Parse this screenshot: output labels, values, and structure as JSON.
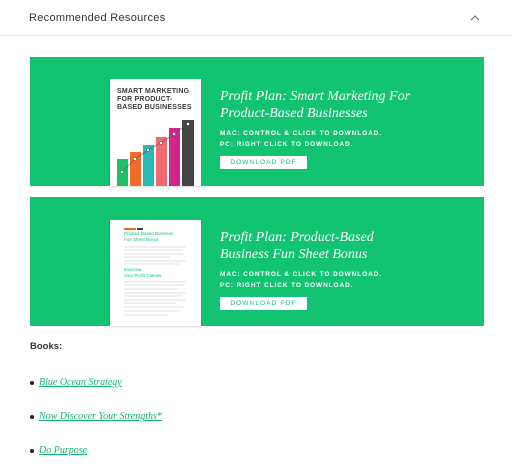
{
  "section": {
    "title": "Recommended Resources",
    "toggle_icon": "chevron-up-icon"
  },
  "colors": {
    "accent_green": "#12c472",
    "link_green": "#12b36b",
    "bar_green": "#1fbf6a",
    "bar_orange": "#f26b2b",
    "bar_teal": "#27b9b4",
    "bar_pink": "#ef6b6f",
    "bar_magenta": "#d0268c",
    "bar_dark": "#444444"
  },
  "resources": [
    {
      "cover_title": "SMART MARKETING FOR PRODUCT-BASED BUSINESSES",
      "title_line1": "Profit Plan: Smart Marketing For",
      "title_line2": "Product-Based Businesses",
      "instr_mac": "MAC: CONTROL & CLICK TO DOWNLOAD.",
      "instr_pc": "PC: RIGHT CLICK TO DOWNLOAD.",
      "button_label": "DOWNLOAD PDF"
    },
    {
      "cover_heading_1": "Product-Based Business",
      "cover_heading_2": "Fun Sheet Bonus",
      "cover_subheading_1": "Exercise",
      "cover_subheading_2": "Your Profit Canvas",
      "title_line1": "Profit Plan: Product-Based",
      "title_line2": "Business Fun Sheet Bonus",
      "instr_mac": "MAC: CONTROL & CLICK TO DOWNLOAD.",
      "instr_pc": "PC: RIGHT CLICK TO DOWNLOAD.",
      "button_label": "DOWNLOAD PDF"
    }
  ],
  "books": {
    "label": "Books:",
    "items": [
      "Blue Ocean Strategy",
      "Now Discover Your Strengths*",
      "Do Purpose"
    ]
  }
}
